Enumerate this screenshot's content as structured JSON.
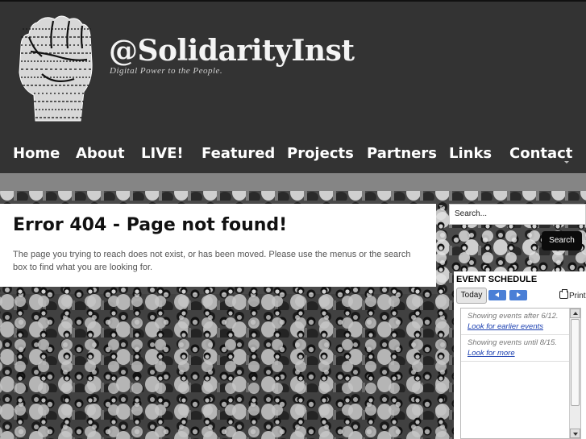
{
  "site": {
    "title": "@SolidarityInst",
    "tagline": "Digital Power to the People."
  },
  "nav": {
    "items": [
      "Home",
      "About",
      "LIVE!",
      "Featured",
      "Projects",
      "Partners",
      "Links",
      "Contact"
    ]
  },
  "error": {
    "title": "Error 404 - Page not found!",
    "message": "The page you trying to reach does not exist, or has been moved. Please use the menus or the search box to find what you are looking for."
  },
  "search": {
    "placeholder": "Search...",
    "button_label": "Search"
  },
  "events": {
    "title": "EVENT SCHEDULE",
    "today_label": "Today",
    "print_label": "Print",
    "rows": [
      {
        "status": "Showing events after 6/12.",
        "link": "Look for earlier events"
      },
      {
        "status": "Showing events until 8/15.",
        "link": "Look for more"
      }
    ]
  },
  "colors": {
    "header_bg": "#333333",
    "nav_text": "#ffffff",
    "link": "#1a3fb0",
    "calendar_button": "#4a7fd6"
  },
  "icons": [
    "raised-fist-logo",
    "chevron-left-icon",
    "chevron-right-icon",
    "printer-icon",
    "scroll-up-icon",
    "scroll-down-icon"
  ]
}
